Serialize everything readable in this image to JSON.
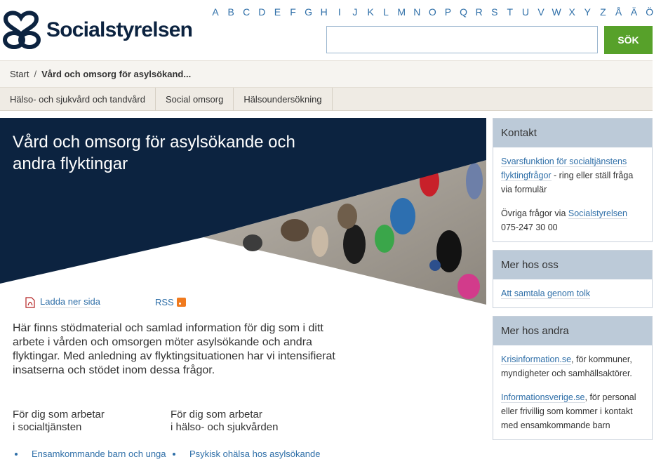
{
  "site": {
    "name": "Socialstyrelsen"
  },
  "alphabet": [
    "A",
    "B",
    "C",
    "D",
    "E",
    "F",
    "G",
    "H",
    "I",
    "J",
    "K",
    "L",
    "M",
    "N",
    "O",
    "P",
    "Q",
    "R",
    "S",
    "T",
    "U",
    "V",
    "W",
    "X",
    "Y",
    "Z",
    "Å",
    "Ä",
    "Ö"
  ],
  "search": {
    "button_label": "SÖK",
    "value": ""
  },
  "breadcrumb": {
    "start": "Start",
    "separator": "/",
    "current": "Vård och omsorg för asylsökand..."
  },
  "nav": {
    "tabs": [
      "Hälso- och sjukvård och tandvård",
      "Social omsorg",
      "Hälsoundersökning"
    ]
  },
  "hero": {
    "title": "Vård och omsorg för asylsökande och andra flyktingar"
  },
  "actions": {
    "download_label": "Ladda ner sida",
    "rss_label": "RSS"
  },
  "intro": "Här finns stödmaterial och samlad information för dig som i ditt arbete i vården och omsorgen möter asylsökande och andra flyktingar. Med anledning av flyktingsituationen har vi intensifierat insatserna och stödet inom dessa frågor.",
  "columns": [
    {
      "heading_line1": "För dig som arbetar",
      "heading_line2": "i socialtjänsten",
      "first_link": "Ensamkommande barn och unga"
    },
    {
      "heading_line1": "För dig som arbetar",
      "heading_line2": "i hälso- och sjukvården",
      "first_link": "Psykisk ohälsa hos asylsökande"
    }
  ],
  "sidebar": {
    "contact": {
      "title": "Kontakt",
      "link1": "Svarsfunktion för socialtjänstens flyktingfrågor",
      "text1": " - ring eller ställ fråga via formulär",
      "text2": "Övriga frågor via ",
      "link2": "Socialstyrelsen",
      "phone": "075-247 30 00"
    },
    "more_us": {
      "title": "Mer hos oss",
      "link": "Att samtala genom tolk"
    },
    "more_others": {
      "title": "Mer hos andra",
      "link1": "Krisinformation.se",
      "text1": ", för kommuner, myndigheter och samhällsaktörer.",
      "link2": "Informationsverige.se",
      "text2": ", för personal eller frivillig som kommer i kontakt med ensamkommande barn"
    }
  },
  "colors": {
    "brand_navy": "#0c2340",
    "link_blue": "#2f6fa8",
    "search_green": "#57a12a",
    "sidebar_head": "#bccad8"
  }
}
